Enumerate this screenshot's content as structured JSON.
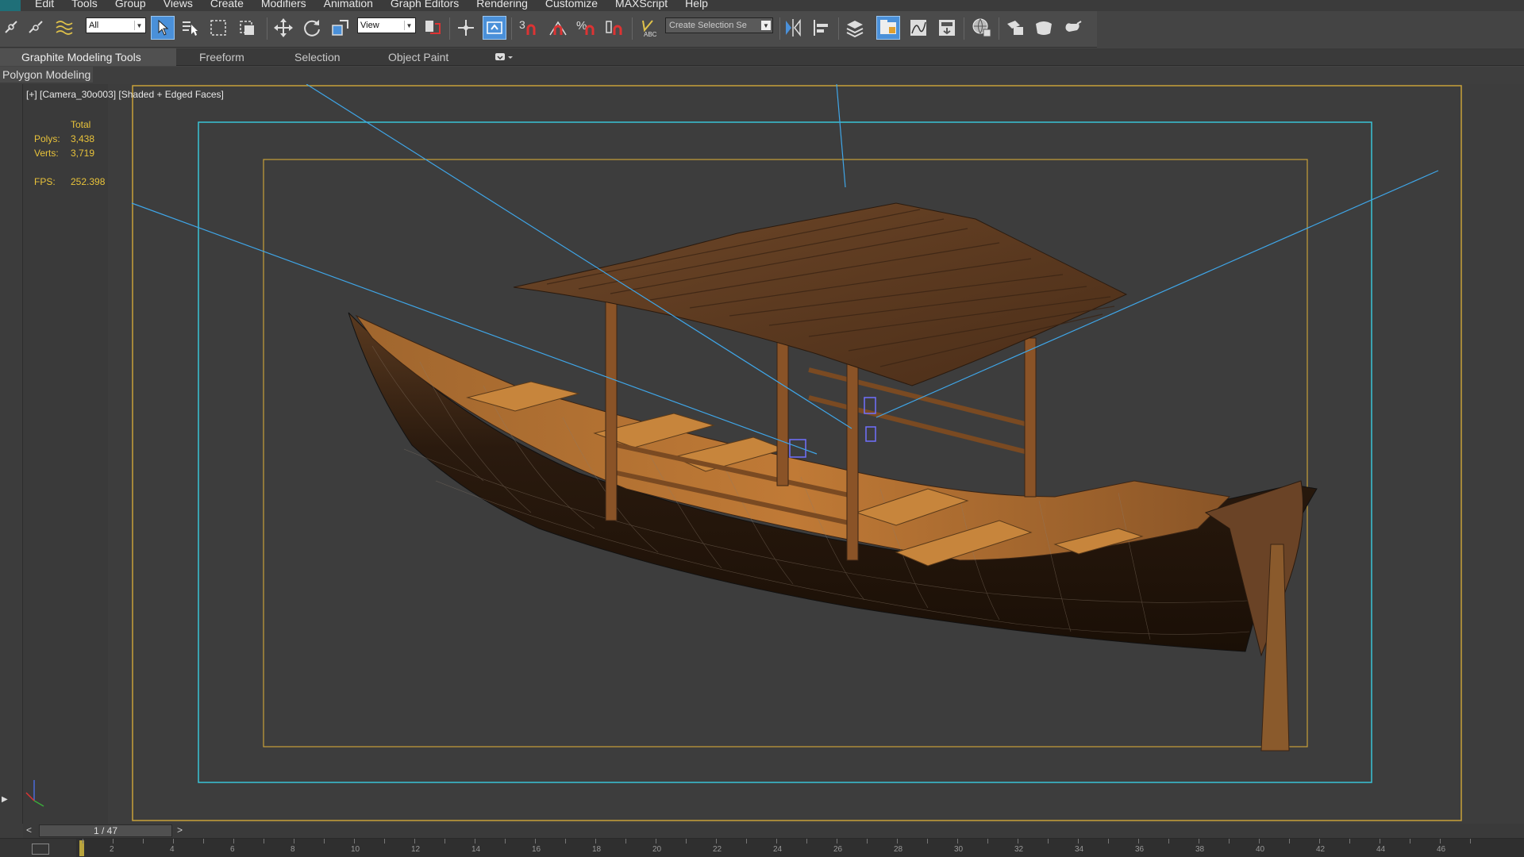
{
  "menu": [
    "Edit",
    "Tools",
    "Group",
    "Views",
    "Create",
    "Modifiers",
    "Animation",
    "Graph Editors",
    "Rendering",
    "Customize",
    "MAXScript",
    "Help"
  ],
  "toolbar": {
    "selection_filter": "All",
    "reference_coord": "View",
    "selection_set_placeholder": "Create Selection Se"
  },
  "ribbon": {
    "tabs": [
      "Graphite Modeling Tools",
      "Freeform",
      "Selection",
      "Object Paint"
    ],
    "active_tab": "Graphite Modeling Tools",
    "panel_label": "Polygon Modeling"
  },
  "viewport": {
    "label": "[+] [Camera_30o003] [Shaded + Edged Faces]",
    "stats": {
      "header": "Total",
      "polys_label": "Polys:",
      "polys_value": "3,438",
      "verts_label": "Verts:",
      "verts_value": "3,719",
      "fps_label": "FPS:",
      "fps_value": "252.398"
    }
  },
  "timeline": {
    "frame_display": "1 / 47",
    "prev": "<",
    "next": ">",
    "tick_labels": [
      "2",
      "4",
      "6",
      "8",
      "10",
      "12",
      "14",
      "16",
      "18",
      "20",
      "22",
      "24",
      "26",
      "28",
      "30",
      "32",
      "34",
      "36",
      "38",
      "40",
      "42",
      "44",
      "46"
    ]
  },
  "colors": {
    "safe_frame_outer": "#c8a13a",
    "safe_frame_action": "#39c3d6",
    "camera_lines": "#3fa6e8",
    "stats_text": "#e9c33a",
    "active_button": "#4a90d9"
  }
}
